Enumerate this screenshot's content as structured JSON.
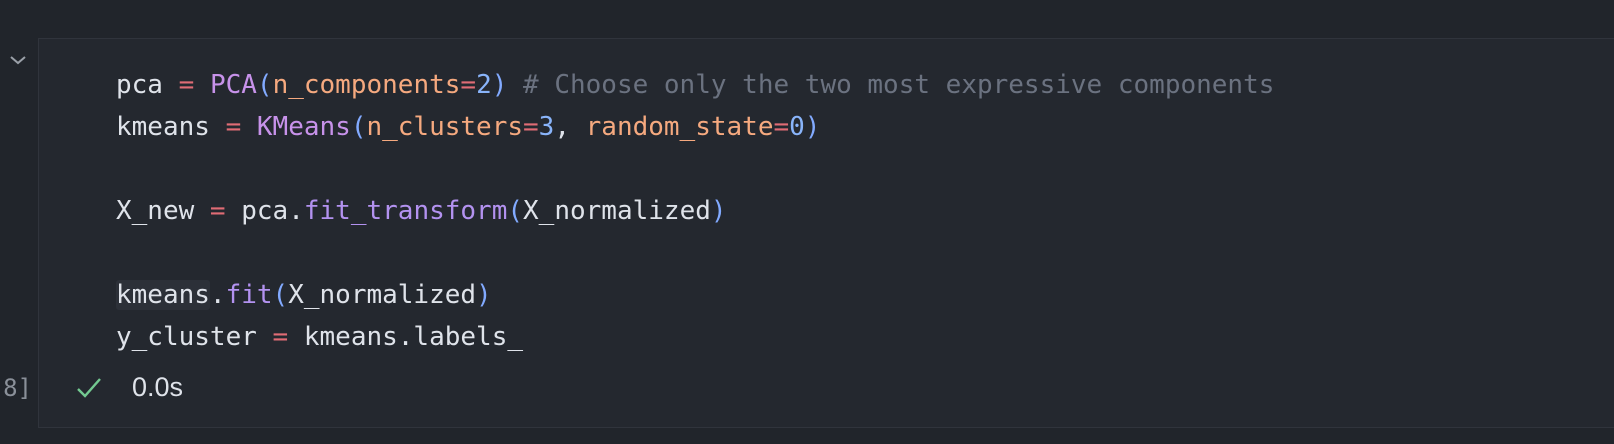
{
  "cell": {
    "execution_count": "[8]",
    "status": {
      "icon": "check-icon",
      "time": "0.0s",
      "color": "#73c991"
    },
    "code": {
      "line1": {
        "var": "pca",
        "op": " = ",
        "cls": "PCA",
        "open": "(",
        "kw": "n_components",
        "eq": "=",
        "num": "2",
        "close": ")",
        "comment": " # Choose only the two most expressive components"
      },
      "line2": {
        "var": "kmeans",
        "op": " = ",
        "cls": "KMeans",
        "open": "(",
        "kw1": "n_clusters",
        "eq1": "=",
        "num1": "3",
        "sep": ", ",
        "kw2": "random_state",
        "eq2": "=",
        "num2": "0",
        "close": ")"
      },
      "line4": {
        "var": "X_new",
        "op": " = ",
        "obj": "pca.",
        "fn": "fit_transform",
        "open": "(",
        "arg": "X_normalized",
        "close": ")"
      },
      "line6": {
        "obj": "kmeans",
        "dot": ".",
        "fn": "fit",
        "open": "(",
        "arg": "X_normalized",
        "close": ")"
      },
      "line7": {
        "var": "y_cluster",
        "op": " = ",
        "rhs": "kmeans.labels_"
      }
    }
  }
}
